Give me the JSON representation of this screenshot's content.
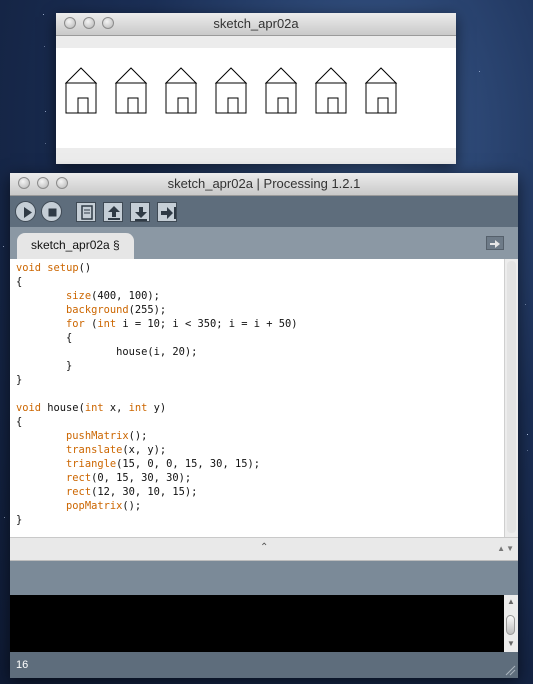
{
  "sketch_window": {
    "title": "sketch_apr02a",
    "house_count": 7
  },
  "ide_window": {
    "title": "sketch_apr02a | Processing 1.2.1",
    "toolbar": [
      {
        "name": "run",
        "icon": "play-icon"
      },
      {
        "name": "stop",
        "icon": "stop-icon"
      },
      {
        "name": "new",
        "icon": "new-document-icon"
      },
      {
        "name": "open",
        "icon": "open-arrow-up-icon"
      },
      {
        "name": "save",
        "icon": "save-arrow-down-icon"
      },
      {
        "name": "export",
        "icon": "export-arrow-icon"
      }
    ],
    "tab_label": "sketch_apr02a §",
    "tab_menu_icon": "arrow-right-icon",
    "code_lines": [
      [
        {
          "t": "void",
          "k": 1
        },
        {
          "t": " "
        },
        {
          "t": "setup",
          "k": 1
        },
        {
          "t": "()"
        }
      ],
      [
        {
          "t": "{"
        }
      ],
      [
        {
          "t": "        "
        },
        {
          "t": "size",
          "k": 1
        },
        {
          "t": "(400, 100);"
        }
      ],
      [
        {
          "t": "        "
        },
        {
          "t": "background",
          "k": 1
        },
        {
          "t": "(255);"
        }
      ],
      [
        {
          "t": "        "
        },
        {
          "t": "for",
          "k": 1
        },
        {
          "t": " ("
        },
        {
          "t": "int",
          "k": 1
        },
        {
          "t": " i = 10; i < 350; i = i + 50)"
        }
      ],
      [
        {
          "t": "        {"
        }
      ],
      [
        {
          "t": "                house(i, 20);"
        }
      ],
      [
        {
          "t": "        }"
        }
      ],
      [
        {
          "t": "}"
        }
      ],
      [
        {
          "t": ""
        }
      ],
      [
        {
          "t": "void",
          "k": 1
        },
        {
          "t": " house("
        },
        {
          "t": "int",
          "k": 1
        },
        {
          "t": " x, "
        },
        {
          "t": "int",
          "k": 1
        },
        {
          "t": " y)"
        }
      ],
      [
        {
          "t": "{"
        }
      ],
      [
        {
          "t": "        "
        },
        {
          "t": "pushMatrix",
          "k": 1
        },
        {
          "t": "();"
        }
      ],
      [
        {
          "t": "        "
        },
        {
          "t": "translate",
          "k": 1
        },
        {
          "t": "(x, y);"
        }
      ],
      [
        {
          "t": "        "
        },
        {
          "t": "triangle",
          "k": 1
        },
        {
          "t": "(15, 0, 0, 15, 30, 15);"
        }
      ],
      [
        {
          "t": "        "
        },
        {
          "t": "rect",
          "k": 1
        },
        {
          "t": "(0, 15, 30, 30);"
        }
      ],
      [
        {
          "t": "        "
        },
        {
          "t": "rect",
          "k": 1
        },
        {
          "t": "(12, 30, 10, 15);"
        }
      ],
      [
        {
          "t": "        "
        },
        {
          "t": "popMatrix",
          "k": 1
        },
        {
          "t": "();"
        }
      ],
      [
        {
          "t": "}"
        }
      ]
    ],
    "keyword_color": "#cc6600",
    "divider_grip": "⌃",
    "line_number": "16"
  }
}
